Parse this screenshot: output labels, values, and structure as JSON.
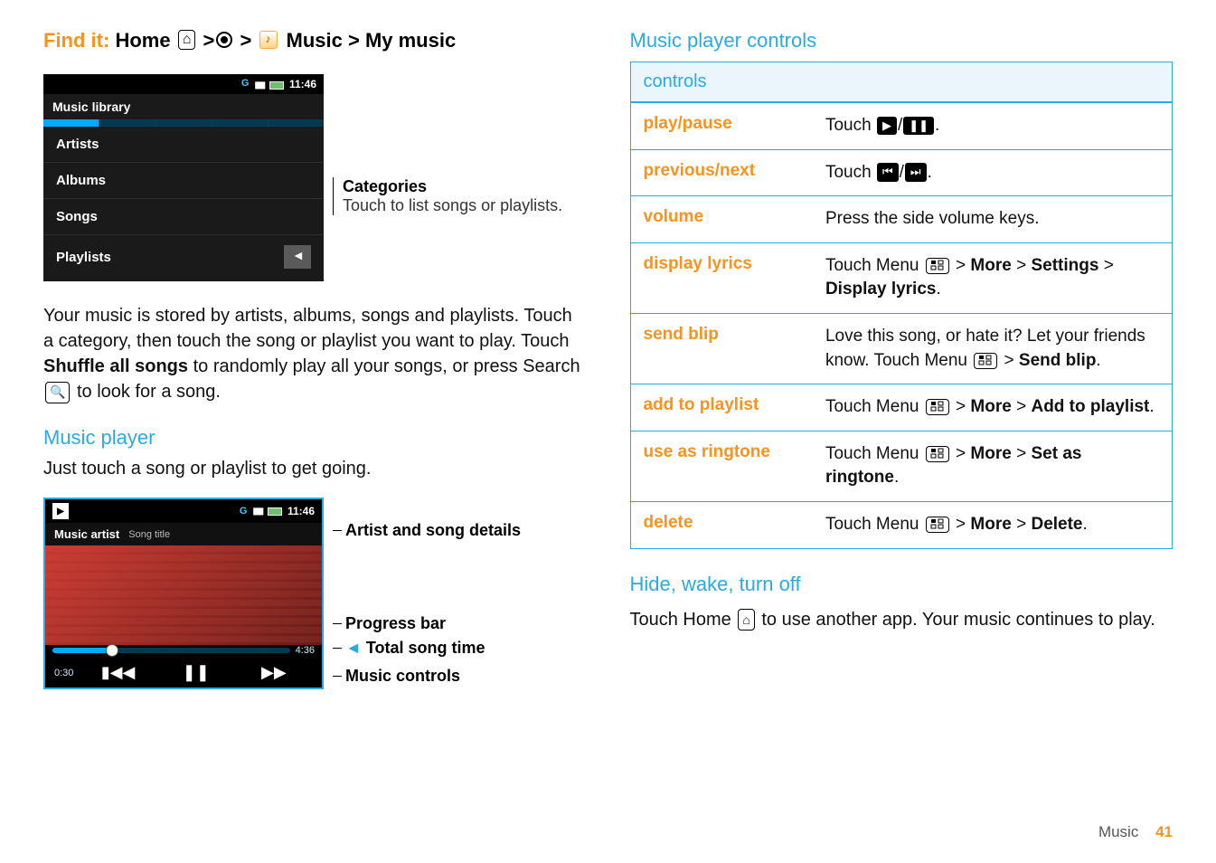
{
  "left": {
    "findit_label": "Find it:",
    "findit_home": "Home",
    "findit_tail": "Music > My music",
    "library": {
      "status_time": "11:46",
      "status_letter": "G",
      "title": "Music library",
      "rows": [
        "Artists",
        "Albums",
        "Songs",
        "Playlists"
      ],
      "callout_title": "Categories",
      "callout_sub": "Touch to list songs or playlists."
    },
    "para_pre": "Your music is stored by artists, albums, songs and playlists. Touch a category, then touch the song or playlist you want to play. Touch ",
    "para_bold": "Shuffle all songs",
    "para_mid": " to randomly play all your songs, or press Search ",
    "para_end": " to look for a song.",
    "h2_player": "Music player",
    "sub_player": "Just touch a song or playlist to get going.",
    "player": {
      "status_time": "11:46",
      "status_letter": "G",
      "artist": "Music artist",
      "song": "Song title",
      "elapsed": "0:30",
      "total": "4:36",
      "callouts": [
        "Artist and song details",
        "Progress bar",
        "Total song time",
        "Music controls"
      ]
    }
  },
  "right": {
    "h2_controls": "Music player controls",
    "table_header": "controls",
    "rows": [
      {
        "k": "play/pause",
        "v_pre": "Touch ",
        "chips": [
          "▶",
          "❚❚"
        ],
        "v_post": "."
      },
      {
        "k": "previous/next",
        "v_pre": "Touch ",
        "chips": [
          "⏮",
          "⏭"
        ],
        "v_post": "."
      },
      {
        "k": "volume",
        "v_plain": "Press the side volume keys."
      },
      {
        "k": "display lyrics",
        "menu": true,
        "v_pre": "Touch Menu ",
        "path": " > More > Settings > Display lyrics",
        "path_bold": [
          "More",
          "Settings",
          "Display lyrics"
        ],
        "v_post": "."
      },
      {
        "k": "send blip",
        "menu": true,
        "v_pre": "Love this song, or hate it? Let your friends know. Touch Menu ",
        "path": " > Send blip",
        "path_bold": [
          "Send blip"
        ],
        "v_post": "."
      },
      {
        "k": "add to playlist",
        "menu": true,
        "v_pre": "Touch Menu ",
        "path": " > More > Add to playlist",
        "path_bold": [
          "More",
          "Add to playlist"
        ],
        "v_post": "."
      },
      {
        "k": "use as ringtone",
        "menu": true,
        "v_pre": "Touch Menu ",
        "path": " > More > Set as ringtone",
        "path_bold": [
          "More",
          "Set as ringtone"
        ],
        "v_post": "."
      },
      {
        "k": "delete",
        "menu": true,
        "v_pre": "Touch Menu ",
        "path": " > More > Delete",
        "path_bold": [
          "More",
          "Delete"
        ],
        "v_post": "."
      }
    ],
    "h2_hide": "Hide, wake, turn off",
    "hide_pre": "Touch Home ",
    "hide_post": " to use another app. Your music continues to play.",
    "footer_cat": "Music",
    "footer_page": "41"
  }
}
